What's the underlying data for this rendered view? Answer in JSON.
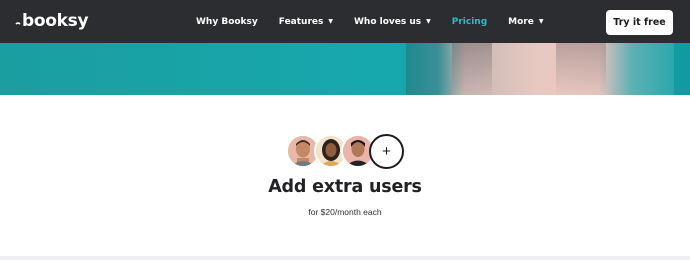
{
  "header": {
    "logo_text": "booksy",
    "nav": [
      {
        "label": "Why Booksy",
        "caret": false,
        "active": false
      },
      {
        "label": "Features",
        "caret": true,
        "active": false
      },
      {
        "label": "Who loves us",
        "caret": true,
        "active": false
      },
      {
        "label": "Pricing",
        "caret": false,
        "active": true
      },
      {
        "label": "More",
        "caret": true,
        "active": false
      }
    ],
    "cta_label": "Try it free"
  },
  "extra_users": {
    "avatars": [
      "avatar-man",
      "avatar-woman",
      "avatar-man"
    ],
    "add_symbol": "+",
    "title": "Add extra users",
    "subtitle": "for $20/month each"
  },
  "colors": {
    "nav_bg": "#2c2d31",
    "accent": "#2bbdc6",
    "teal": "#17a8ae"
  }
}
